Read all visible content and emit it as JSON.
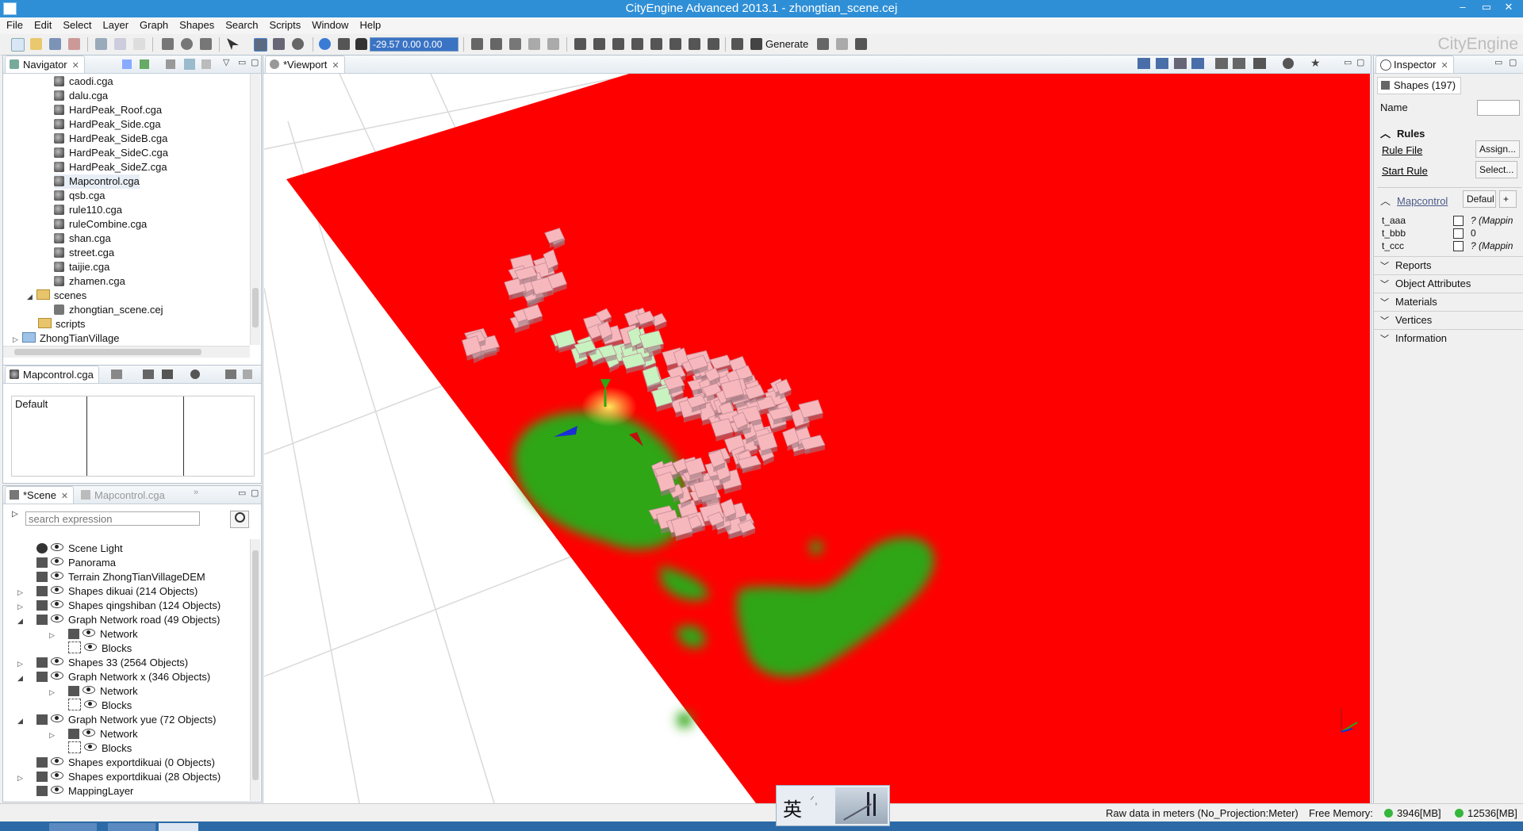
{
  "window": {
    "title": "CityEngine Advanced 2013.1 - zhongtian_scene.cej",
    "controls": [
      "–",
      "▭",
      "✕"
    ]
  },
  "menu": [
    "File",
    "Edit",
    "Select",
    "Layer",
    "Graph",
    "Shapes",
    "Search",
    "Scripts",
    "Window",
    "Help"
  ],
  "toolbar": {
    "coord_value": "-29.57 0.00 0.00",
    "generate_label": "Generate",
    "brand": "CityEngine"
  },
  "navigator": {
    "tab_label": "Navigator",
    "files": [
      "caodi.cga",
      "dalu.cga",
      "HardPeak_Roof.cga",
      "HardPeak_Side.cga",
      "HardPeak_SideB.cga",
      "HardPeak_SideC.cga",
      "HardPeak_SideZ.cga",
      "Mapcontrol.cga",
      "qsb.cga",
      "rule110.cga",
      "ruleCombine.cga",
      "shan.cga",
      "street.cga",
      "taijie.cga",
      "zhamen.cga"
    ],
    "folders": {
      "scenes": "scenes",
      "scene_file": "zhongtian_scene.cej",
      "scripts": "scripts",
      "project": "ZhongTianVillage"
    }
  },
  "rule_panel": {
    "tab_label": "Mapcontrol.cga",
    "default_label": "Default"
  },
  "scene_panel": {
    "tab_label": "*Scene",
    "inactive_tab": "Mapcontrol.cga",
    "search_placeholder": "search expression",
    "layers": [
      {
        "label": "Scene Light",
        "level": 0,
        "expander": ""
      },
      {
        "label": "Panorama",
        "level": 0,
        "expander": ""
      },
      {
        "label": "Terrain ZhongTianVillageDEM",
        "level": 0,
        "expander": ""
      },
      {
        "label": "Shapes dikuai (214 Objects)",
        "level": 0,
        "expander": "▷"
      },
      {
        "label": "Shapes qingshiban (124 Objects)",
        "level": 0,
        "expander": "▷"
      },
      {
        "label": "Graph Network road (49 Objects)",
        "level": 0,
        "expander": "◢"
      },
      {
        "label": "Network",
        "level": 1,
        "expander": "▷"
      },
      {
        "label": "Blocks",
        "level": 1,
        "expander": ""
      },
      {
        "label": "Shapes 33 (2564 Objects)",
        "level": 0,
        "expander": "▷"
      },
      {
        "label": "Graph Network x (346 Objects)",
        "level": 0,
        "expander": "◢"
      },
      {
        "label": "Network",
        "level": 1,
        "expander": "▷"
      },
      {
        "label": "Blocks",
        "level": 1,
        "expander": ""
      },
      {
        "label": "Graph Network yue (72 Objects)",
        "level": 0,
        "expander": "◢"
      },
      {
        "label": "Network",
        "level": 1,
        "expander": "▷"
      },
      {
        "label": "Blocks",
        "level": 1,
        "expander": ""
      },
      {
        "label": "Shapes exportdikuai (0 Objects)",
        "level": 0,
        "expander": ""
      },
      {
        "label": "Shapes exportdikuai (28 Objects)",
        "level": 0,
        "expander": "▷"
      },
      {
        "label": "MappingLayer",
        "level": 0,
        "expander": ""
      }
    ]
  },
  "viewport": {
    "tab_label": "*Viewport",
    "terrain_color": "#ff0000",
    "vegetation_color": "#2ea614",
    "building_color": "#f7b8bd",
    "highlight_color": "#c8f2c0"
  },
  "inspector": {
    "tab_label": "Inspector",
    "shapes_count": "Shapes (197)",
    "name_label": "Name",
    "rules_header": "Rules",
    "rule_file_label": "Rule File",
    "assign_button": "Assign...",
    "start_rule_label": "Start Rule",
    "select_button": "Select...",
    "mapcontrol_label": "Mapcontrol",
    "default_button": "Defaul",
    "attributes": [
      {
        "name": "t_aaa",
        "value": "? (Mappin"
      },
      {
        "name": "t_bbb",
        "value": "0"
      },
      {
        "name": "t_ccc",
        "value": "? (Mappin"
      }
    ],
    "sections": [
      "Reports",
      "Object Attributes",
      "Materials",
      "Vertices",
      "Information"
    ]
  },
  "status": {
    "raw_data": "Raw data in meters (No_Projection:Meter)",
    "free_memory_label": "Free Memory:",
    "mem1": "3946[MB]",
    "mem2": "12536[MB]"
  },
  "ime": {
    "char": "英"
  }
}
